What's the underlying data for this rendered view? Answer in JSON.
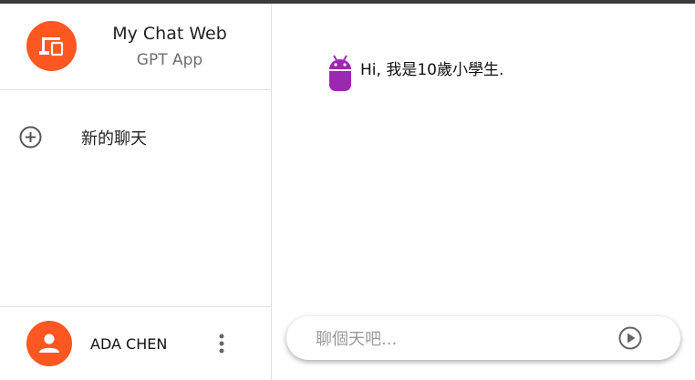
{
  "app": {
    "title": "My Chat Web",
    "subtitle": "GPT App"
  },
  "sidebar": {
    "new_chat_label": "新的聊天"
  },
  "user": {
    "name": "ADA CHEN"
  },
  "messages": [
    {
      "sender": "bot",
      "text": "Hi, 我是10歲小學生."
    }
  ],
  "composer": {
    "placeholder": "聊個天吧..."
  },
  "colors": {
    "accent": "#ff5722",
    "bot": "#9c27b0"
  }
}
